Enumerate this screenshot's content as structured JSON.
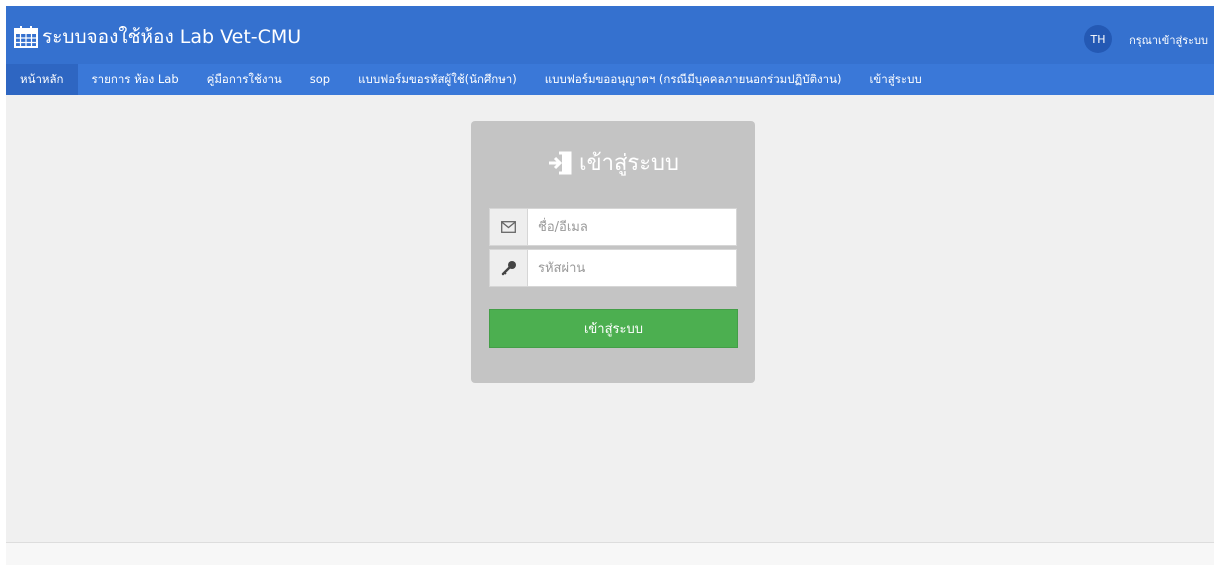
{
  "header": {
    "title": "ระบบจองใช้ห้อง Lab Vet-CMU",
    "lang_badge": "TH",
    "login_hint": "กรุณาเข้าสู่ระบบ"
  },
  "nav": {
    "items": [
      {
        "label": "หน้าหลัก"
      },
      {
        "label": "รายการ ห้อง Lab"
      },
      {
        "label": "คู่มือการใช้งาน"
      },
      {
        "label": "sop"
      },
      {
        "label": "แบบฟอร์มขอรหัสผู้ใช้(นักศึกษา)"
      },
      {
        "label": "แบบฟอร์มขออนุญาตฯ (กรณีมีบุคคลภายนอกร่วมปฏิบัติงาน)"
      },
      {
        "label": "เข้าสู่ระบบ"
      }
    ]
  },
  "login": {
    "title": "เข้าสู่ระบบ",
    "username_placeholder": "ชื่อ/อีเมล",
    "password_placeholder": "รหัสผ่าน",
    "submit_label": "เข้าสู่ระบบ"
  },
  "colors": {
    "header": "#3571cf",
    "nav": "#3a78d8",
    "card": "#c4c4c4",
    "button": "#4caf50"
  },
  "icons": {
    "brand": "calendar-icon",
    "login_title": "sign-in-icon",
    "username": "envelope-icon",
    "password": "key-icon"
  }
}
